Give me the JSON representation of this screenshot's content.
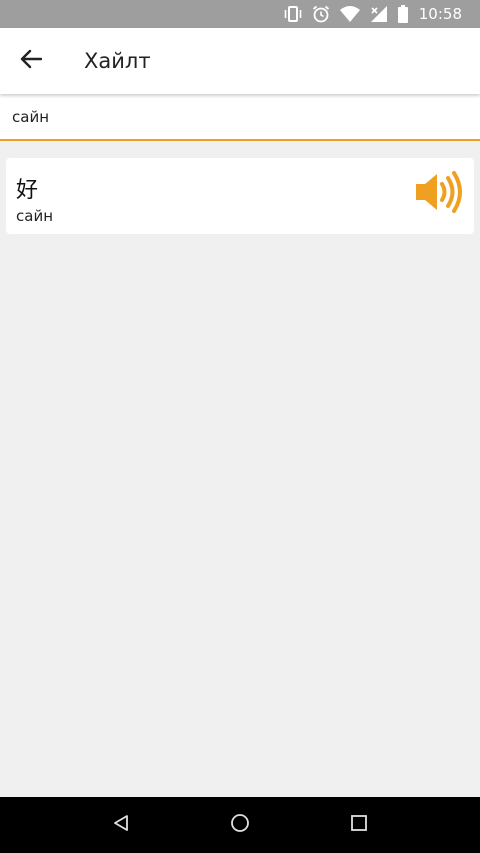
{
  "status_bar": {
    "time": "10:58",
    "icons": [
      "vibrate-icon",
      "alarm-icon",
      "wifi-icon",
      "signal-icon",
      "battery-icon"
    ]
  },
  "app_bar": {
    "title": "Хайлт",
    "back_icon": "arrow-left-icon"
  },
  "search": {
    "value": "сайн"
  },
  "results": [
    {
      "character": "好",
      "meaning": "сайн",
      "audio_icon": "speaker-icon"
    }
  ],
  "nav_bar": {
    "icons": [
      "back-triangle-icon",
      "home-circle-icon",
      "recents-square-icon"
    ]
  },
  "colors": {
    "accent": "#F0A020",
    "status_bar": "#9E9E9E",
    "background": "#F0F0F0",
    "nav_bar": "#000000"
  }
}
